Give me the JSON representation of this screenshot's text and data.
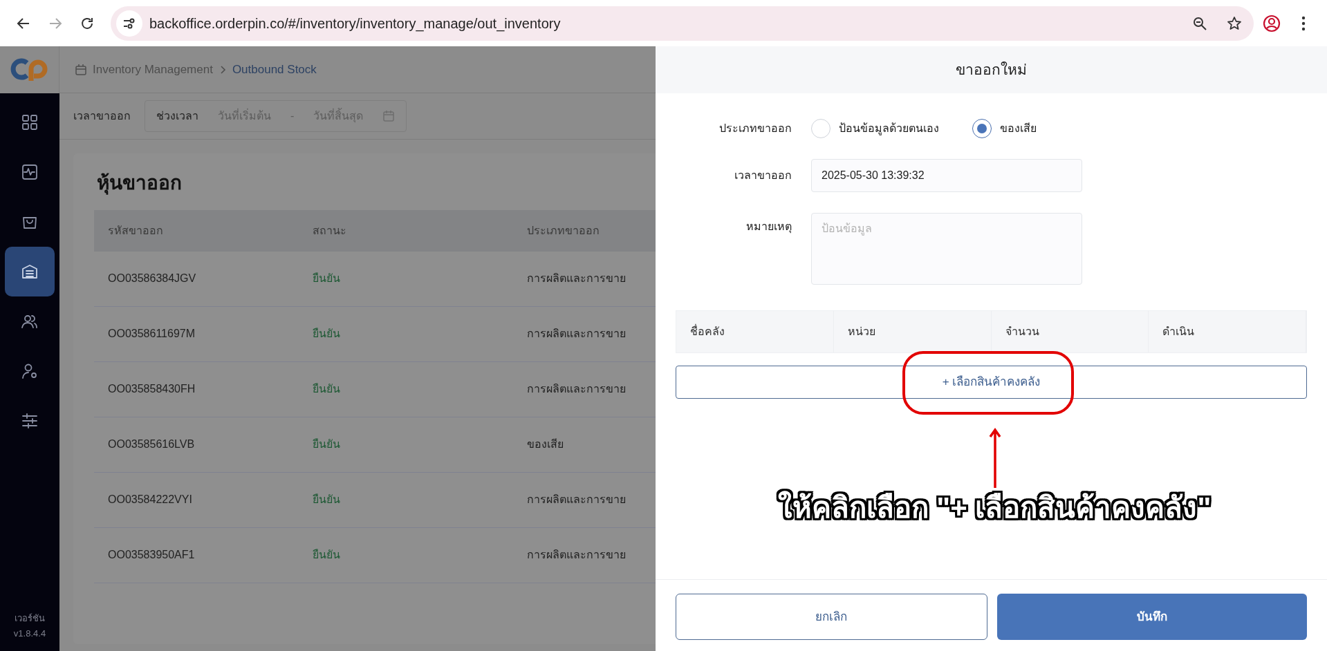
{
  "browser": {
    "url": "backoffice.orderpin.co/#/inventory/inventory_manage/out_inventory"
  },
  "breadcrumb": [
    {
      "label": "Inventory Management",
      "selected": false
    },
    {
      "label": "Outbound Stock",
      "selected": true
    }
  ],
  "sidebar": {
    "items": [
      {
        "selected": false
      },
      {
        "selected": false
      },
      {
        "selected": false
      },
      {
        "selected": true
      },
      {
        "selected": false
      },
      {
        "selected": false
      },
      {
        "selected": false
      }
    ],
    "version_label": "เวอร์ชัน",
    "version": "v1.8.4.4"
  },
  "filter": {
    "label": "เวลาขาออก",
    "range_label": "ช่วงเวลา",
    "start_placeholder": "วันที่เริ่มต้น",
    "separator": "-",
    "end_placeholder": "วันที่สิ้นสุด"
  },
  "page_title": "หุ้นขาออก",
  "table": {
    "columns": [
      "รหัสขาออก",
      "สถานะ",
      "ประเภทขาออก"
    ],
    "rows": [
      {
        "code": "OO03586384JGV",
        "status": "ยืนยัน",
        "type": "การผลิตและการขาย"
      },
      {
        "code": "OO0358611697M",
        "status": "ยืนยัน",
        "type": "การผลิตและการขาย"
      },
      {
        "code": "OO035858430FH",
        "status": "ยืนยัน",
        "type": "การผลิตและการขาย"
      },
      {
        "code": "OO03585616LVB",
        "status": "ยืนยัน",
        "type": "ของเสีย"
      },
      {
        "code": "OO03584222VYI",
        "status": "ยืนยัน",
        "type": "การผลิตและการขาย"
      },
      {
        "code": "OO03583950AF1",
        "status": "ยืนยัน",
        "type": "การผลิตและการขาย"
      }
    ]
  },
  "drawer": {
    "title": "ขาออกใหม่",
    "type_label": "ประเภทขาออก",
    "type_options": [
      {
        "label": "ป้อนข้อมูลด้วยตนเอง",
        "selected": false
      },
      {
        "label": "ของเสีย",
        "selected": true
      }
    ],
    "time_label": "เวลาขาออก",
    "time_value": "2025-05-30 13:39:32",
    "note_label": "หมายเหตุ",
    "note_placeholder": "ป้อนข้อมูล",
    "items_columns": [
      "ชื่อคลัง",
      "หน่วย",
      "จำนวน",
      "ดำเนิน"
    ],
    "add_button": "+ เลือกสินค้าคงคลัง",
    "cancel_button": "ยกเลิก",
    "save_button": "บันทึก"
  },
  "annotation": {
    "caption": "ให้คลิกเลือก \"+ เลือกสินค้าคงคลัง\""
  }
}
